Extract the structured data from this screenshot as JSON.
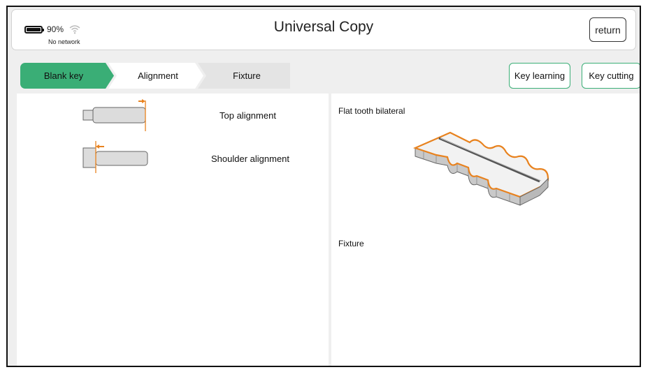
{
  "status": {
    "battery_percent": "90%",
    "battery_level": 0.9,
    "network": "No network",
    "icons": [
      "battery-icon",
      "wifi-icon"
    ]
  },
  "header": {
    "title": "Universal Copy",
    "return_label": "return"
  },
  "steps": [
    {
      "label": "Blank key",
      "active": true
    },
    {
      "label": "Alignment",
      "active": false
    },
    {
      "label": "Fixture",
      "active": false
    }
  ],
  "actions": {
    "key_learning": "Key learning",
    "key_cutting": "Key cutting"
  },
  "alignment": {
    "options": [
      {
        "label": "Top alignment",
        "icon": "top-alignment-icon"
      },
      {
        "label": "Shoulder alignment",
        "icon": "shoulder-alignment-icon"
      }
    ]
  },
  "key_info": {
    "type_label": "Flat tooth bilateral",
    "fixture_label": "Fixture",
    "image": "flat-tooth-bilateral-key-image"
  },
  "colors": {
    "accent_green": "#3aae76",
    "orange": "#e8821e",
    "panel_bg": "#efefef"
  }
}
